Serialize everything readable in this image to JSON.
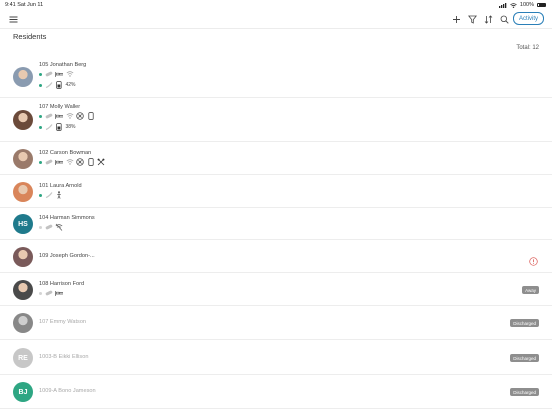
{
  "status_bar": {
    "time": "9:41",
    "date": "Sat Jun 11",
    "battery": "100%"
  },
  "toolbar": {
    "menu_icon": "hamburger-menu-icon",
    "actions": [
      "plus-icon",
      "filter-icon",
      "sort-icon",
      "search-icon"
    ],
    "activity_label": "Activity"
  },
  "section_title": "Residents",
  "total_label": "Total: 12",
  "colors": {
    "accent": "#2a7fb8",
    "status_green": "#2ea683",
    "alert_red": "#d9534f",
    "badge_gray": "#8e8e8e"
  },
  "residents": [
    {
      "name": "105 Jonathan Berg",
      "avatar": "photo",
      "line1": [
        "pill-icon",
        "bed-icon",
        "wifi-icon"
      ],
      "line2": [
        "sensor-icon",
        "phone-battery-icon"
      ],
      "battery": "42%"
    },
    {
      "name": "107 Molly Waller",
      "avatar": "photo",
      "line1": [
        "pill-icon",
        "bed-icon",
        "wifi-icon",
        "no-entry-icon",
        "phone-icon"
      ],
      "line2": [
        "sensor-icon",
        "phone-battery-icon"
      ],
      "battery": "38%"
    },
    {
      "name": "102 Carson Bowman",
      "avatar": "photo",
      "line1": [
        "pill-icon",
        "bed-icon",
        "wifi-icon",
        "no-entry-icon",
        "phone-icon",
        "tools-icon"
      ]
    },
    {
      "name": "101 Laura Arnold",
      "avatar": "photo",
      "line1": [
        "sensor-icon",
        "person-standing-icon"
      ]
    },
    {
      "name": "104 Harman Simmons",
      "avatar": "initials",
      "initials": "HS",
      "avatar_color": "#1f7a8c",
      "line1": [
        "pill-icon",
        "no-wifi-icon"
      ],
      "dot": "gray"
    },
    {
      "name": "109 Joseph Gordon-...",
      "avatar": "photo",
      "alert": "alert-circle-icon"
    },
    {
      "name": "108 Harrison Ford",
      "avatar": "photo",
      "line1": [
        "pill-icon",
        "bed-icon"
      ],
      "dot": "gray",
      "badge": "Away"
    },
    {
      "name": "107 Emmy Watson",
      "avatar": "photo",
      "dim": true,
      "badge": "Discharged"
    },
    {
      "name": "1003-B Eikki Ellison",
      "avatar": "initials",
      "initials": "RE",
      "avatar_color": "#c7c7c7",
      "dim": true,
      "badge": "Discharged"
    },
    {
      "name": "1009-A Bono Jameson",
      "avatar": "initials",
      "initials": "BJ",
      "avatar_color": "#2ea683",
      "dim": true,
      "badge": "Discharged"
    }
  ]
}
